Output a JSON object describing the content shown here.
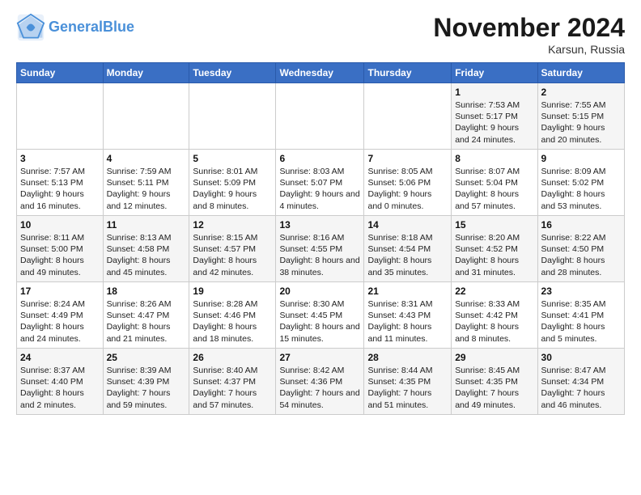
{
  "header": {
    "logo_line1": "General",
    "logo_line2": "Blue",
    "month": "November 2024",
    "location": "Karsun, Russia"
  },
  "weekdays": [
    "Sunday",
    "Monday",
    "Tuesday",
    "Wednesday",
    "Thursday",
    "Friday",
    "Saturday"
  ],
  "weeks": [
    [
      {
        "day": "",
        "info": ""
      },
      {
        "day": "",
        "info": ""
      },
      {
        "day": "",
        "info": ""
      },
      {
        "day": "",
        "info": ""
      },
      {
        "day": "",
        "info": ""
      },
      {
        "day": "1",
        "info": "Sunrise: 7:53 AM\nSunset: 5:17 PM\nDaylight: 9 hours and 24 minutes."
      },
      {
        "day": "2",
        "info": "Sunrise: 7:55 AM\nSunset: 5:15 PM\nDaylight: 9 hours and 20 minutes."
      }
    ],
    [
      {
        "day": "3",
        "info": "Sunrise: 7:57 AM\nSunset: 5:13 PM\nDaylight: 9 hours and 16 minutes."
      },
      {
        "day": "4",
        "info": "Sunrise: 7:59 AM\nSunset: 5:11 PM\nDaylight: 9 hours and 12 minutes."
      },
      {
        "day": "5",
        "info": "Sunrise: 8:01 AM\nSunset: 5:09 PM\nDaylight: 9 hours and 8 minutes."
      },
      {
        "day": "6",
        "info": "Sunrise: 8:03 AM\nSunset: 5:07 PM\nDaylight: 9 hours and 4 minutes."
      },
      {
        "day": "7",
        "info": "Sunrise: 8:05 AM\nSunset: 5:06 PM\nDaylight: 9 hours and 0 minutes."
      },
      {
        "day": "8",
        "info": "Sunrise: 8:07 AM\nSunset: 5:04 PM\nDaylight: 8 hours and 57 minutes."
      },
      {
        "day": "9",
        "info": "Sunrise: 8:09 AM\nSunset: 5:02 PM\nDaylight: 8 hours and 53 minutes."
      }
    ],
    [
      {
        "day": "10",
        "info": "Sunrise: 8:11 AM\nSunset: 5:00 PM\nDaylight: 8 hours and 49 minutes."
      },
      {
        "day": "11",
        "info": "Sunrise: 8:13 AM\nSunset: 4:58 PM\nDaylight: 8 hours and 45 minutes."
      },
      {
        "day": "12",
        "info": "Sunrise: 8:15 AM\nSunset: 4:57 PM\nDaylight: 8 hours and 42 minutes."
      },
      {
        "day": "13",
        "info": "Sunrise: 8:16 AM\nSunset: 4:55 PM\nDaylight: 8 hours and 38 minutes."
      },
      {
        "day": "14",
        "info": "Sunrise: 8:18 AM\nSunset: 4:54 PM\nDaylight: 8 hours and 35 minutes."
      },
      {
        "day": "15",
        "info": "Sunrise: 8:20 AM\nSunset: 4:52 PM\nDaylight: 8 hours and 31 minutes."
      },
      {
        "day": "16",
        "info": "Sunrise: 8:22 AM\nSunset: 4:50 PM\nDaylight: 8 hours and 28 minutes."
      }
    ],
    [
      {
        "day": "17",
        "info": "Sunrise: 8:24 AM\nSunset: 4:49 PM\nDaylight: 8 hours and 24 minutes."
      },
      {
        "day": "18",
        "info": "Sunrise: 8:26 AM\nSunset: 4:47 PM\nDaylight: 8 hours and 21 minutes."
      },
      {
        "day": "19",
        "info": "Sunrise: 8:28 AM\nSunset: 4:46 PM\nDaylight: 8 hours and 18 minutes."
      },
      {
        "day": "20",
        "info": "Sunrise: 8:30 AM\nSunset: 4:45 PM\nDaylight: 8 hours and 15 minutes."
      },
      {
        "day": "21",
        "info": "Sunrise: 8:31 AM\nSunset: 4:43 PM\nDaylight: 8 hours and 11 minutes."
      },
      {
        "day": "22",
        "info": "Sunrise: 8:33 AM\nSunset: 4:42 PM\nDaylight: 8 hours and 8 minutes."
      },
      {
        "day": "23",
        "info": "Sunrise: 8:35 AM\nSunset: 4:41 PM\nDaylight: 8 hours and 5 minutes."
      }
    ],
    [
      {
        "day": "24",
        "info": "Sunrise: 8:37 AM\nSunset: 4:40 PM\nDaylight: 8 hours and 2 minutes."
      },
      {
        "day": "25",
        "info": "Sunrise: 8:39 AM\nSunset: 4:39 PM\nDaylight: 7 hours and 59 minutes."
      },
      {
        "day": "26",
        "info": "Sunrise: 8:40 AM\nSunset: 4:37 PM\nDaylight: 7 hours and 57 minutes."
      },
      {
        "day": "27",
        "info": "Sunrise: 8:42 AM\nSunset: 4:36 PM\nDaylight: 7 hours and 54 minutes."
      },
      {
        "day": "28",
        "info": "Sunrise: 8:44 AM\nSunset: 4:35 PM\nDaylight: 7 hours and 51 minutes."
      },
      {
        "day": "29",
        "info": "Sunrise: 8:45 AM\nSunset: 4:35 PM\nDaylight: 7 hours and 49 minutes."
      },
      {
        "day": "30",
        "info": "Sunrise: 8:47 AM\nSunset: 4:34 PM\nDaylight: 7 hours and 46 minutes."
      }
    ]
  ]
}
